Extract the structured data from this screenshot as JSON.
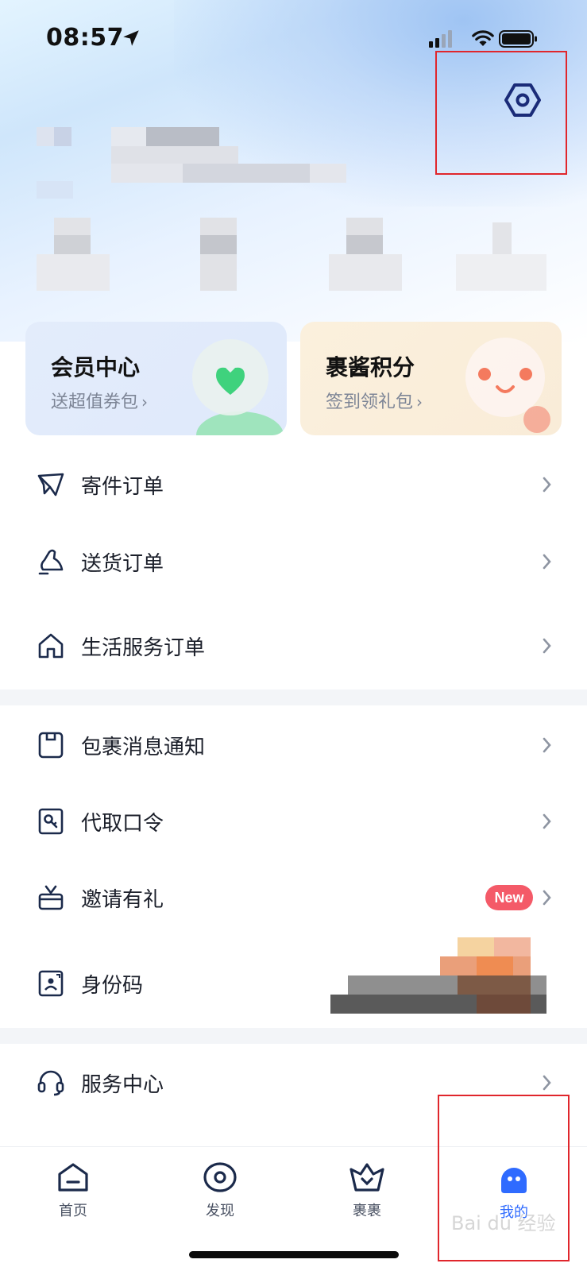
{
  "status_bar": {
    "time": "08:57"
  },
  "settings": {
    "icon": "settings-hexagon-icon"
  },
  "cards": [
    {
      "title": "会员中心",
      "subtitle": "送超值券包"
    },
    {
      "title": "裹酱积分",
      "subtitle": "签到领礼包"
    }
  ],
  "list_group_1": [
    {
      "label": "寄件订单"
    },
    {
      "label": "送货订单"
    },
    {
      "label": "生活服务订单"
    }
  ],
  "list_group_2": [
    {
      "label": "包裹消息通知"
    },
    {
      "label": "代取口令"
    },
    {
      "label": "邀请有礼",
      "badge": "New"
    },
    {
      "label": "身份码"
    }
  ],
  "list_group_3": [
    {
      "label": "服务中心"
    }
  ],
  "bottom_nav": [
    {
      "label": "首页",
      "icon": "home-icon"
    },
    {
      "label": "发现",
      "icon": "discover-icon"
    },
    {
      "label": "裹裹",
      "icon": "guoguo-crown-icon"
    },
    {
      "label": "我的",
      "icon": "profile-icon",
      "active": true
    }
  ],
  "watermark": "Bai du 经验",
  "colors": {
    "accent": "#2f6bff",
    "highlight": "#e0262c",
    "badge": "#f45a68"
  }
}
